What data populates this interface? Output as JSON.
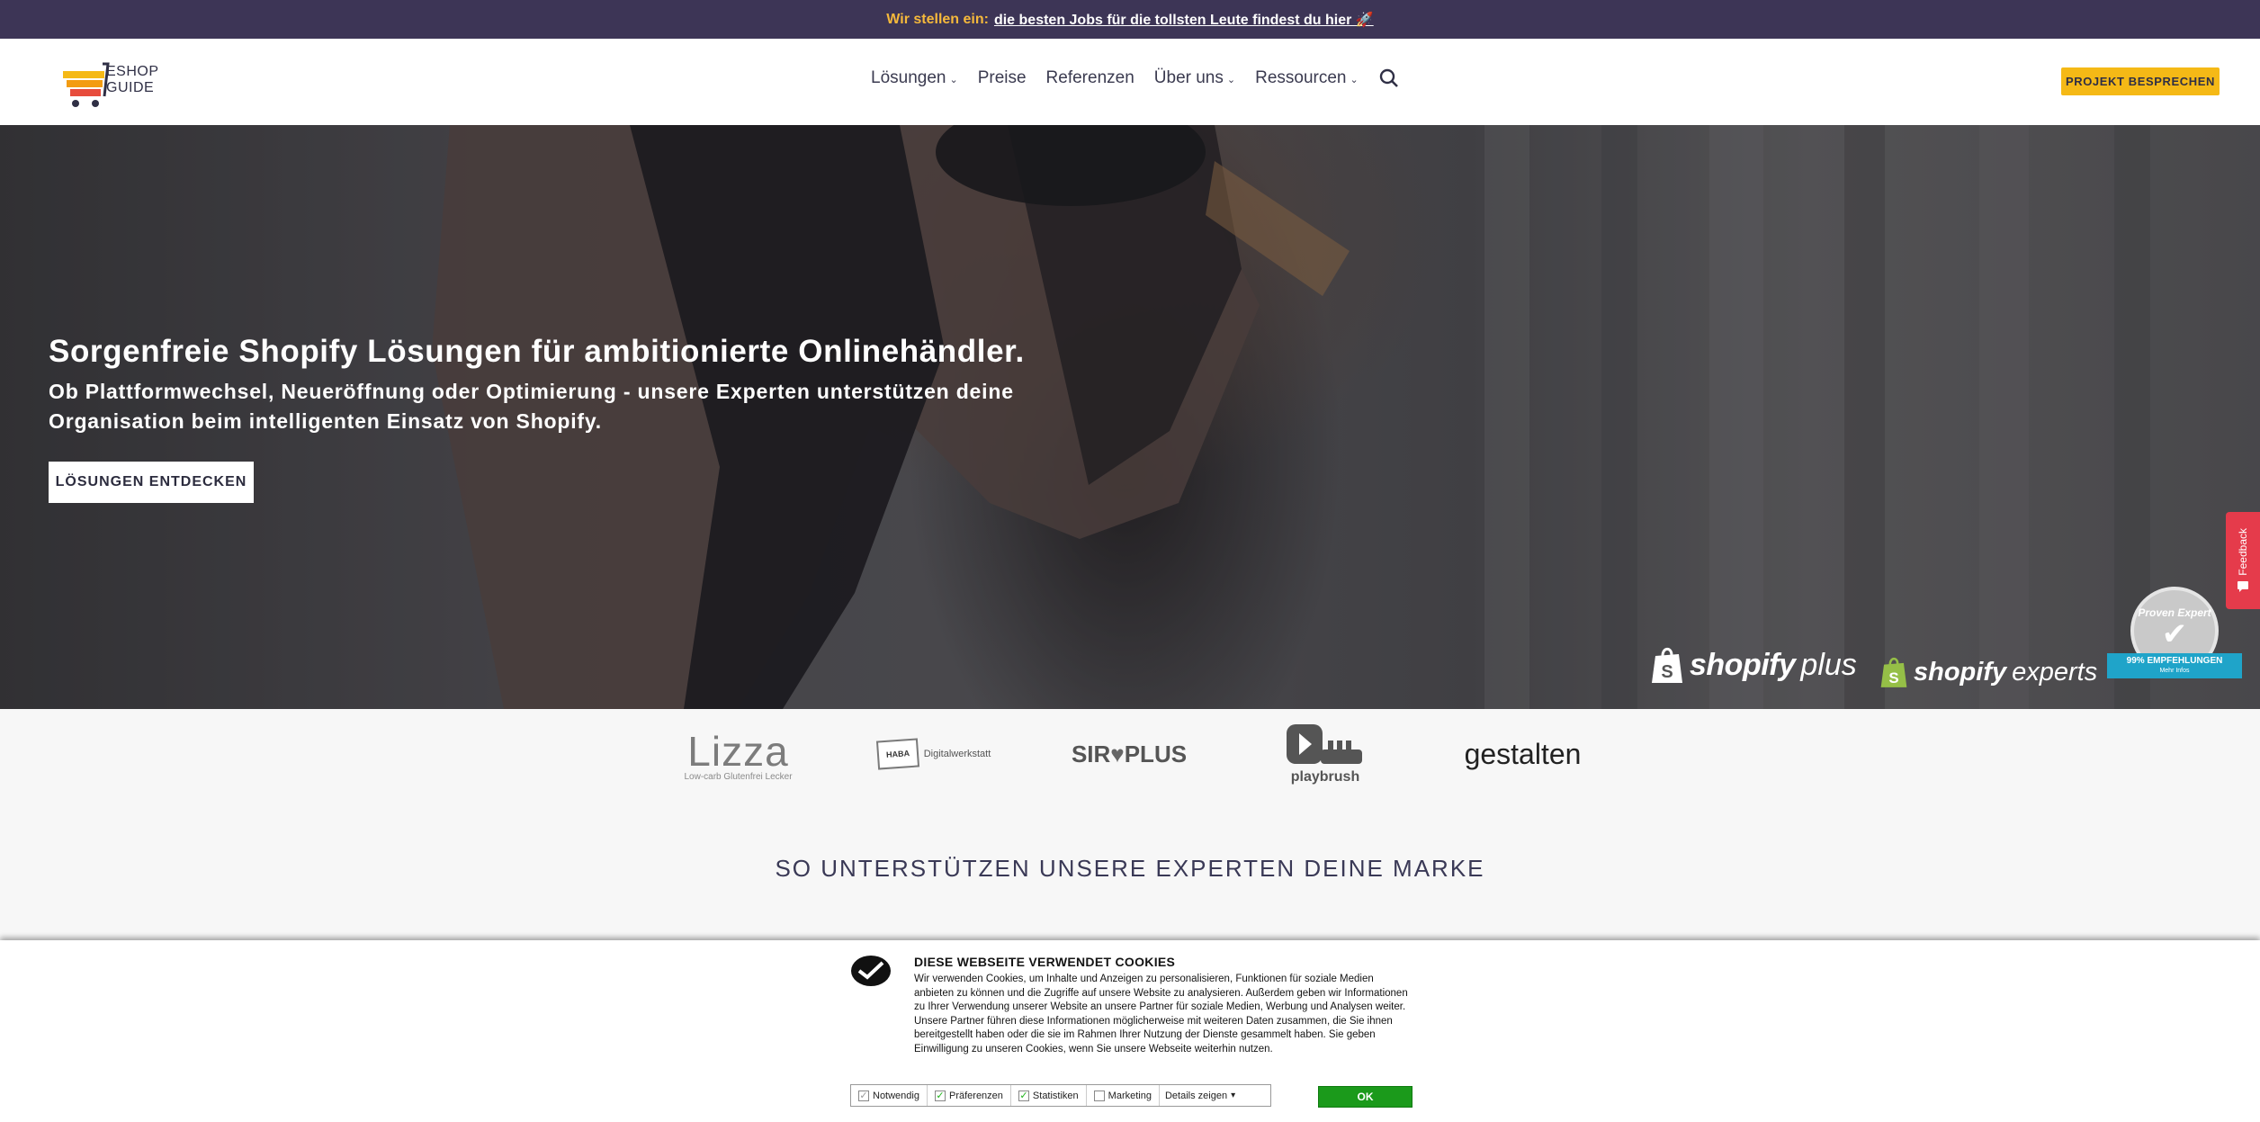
{
  "announcement": {
    "lead": "Wir stellen ein:",
    "link": "die besten Jobs für die tollsten Leute findest du hier 🚀"
  },
  "header": {
    "logo_line1": "ESHOP",
    "logo_line2": "GUIDE",
    "nav": [
      {
        "label": "Lösungen",
        "has_dropdown": true
      },
      {
        "label": "Preise",
        "has_dropdown": false
      },
      {
        "label": "Referenzen",
        "has_dropdown": false
      },
      {
        "label": "Über uns",
        "has_dropdown": true
      },
      {
        "label": "Ressourcen",
        "has_dropdown": true
      }
    ],
    "search_icon": "search-icon",
    "cta": "PROJEKT BESPRECHEN"
  },
  "hero": {
    "title": "Sorgenfreie Shopify Lösungen für ambitionierte Onlinehändler.",
    "subtitle": "Ob Plattformwechsel, Neueröffnung oder Optimierung - unsere Experten unterstützen deine Organisation beim intelligenten Einsatz von Shopify.",
    "button": "LÖSUNGEN ENTDECKEN",
    "badges": {
      "shopify_plus_word": "shopify",
      "shopify_plus_suffix": "plus",
      "shopify_experts_word": "shopify",
      "shopify_experts_suffix": "experts"
    },
    "seal": {
      "name": "Proven Expert",
      "ribbon": "99% EMPFEHLUNGEN",
      "more": "Mehr Infos"
    }
  },
  "feedback": {
    "label": "Feedback"
  },
  "client_logos": {
    "lizza_name": "Lizza",
    "lizza_tag": "Low-carb Glutenfrei Lecker",
    "haba_box": "HABA",
    "haba_text": "Digitalwerkstatt",
    "sirplus_left": "SIR",
    "sirplus_right": "PLUS",
    "playbrush": "playbrush",
    "gestalten": "gestalten"
  },
  "section": {
    "title": "SO UNTERSTÜTZEN UNSERE EXPERTEN DEINE MARKE"
  },
  "cookie": {
    "title": "DIESE WEBSEITE VERWENDET COOKIES",
    "text": "Wir verwenden Cookies, um Inhalte und Anzeigen zu personalisieren, Funktionen für soziale Medien anbieten zu können und die Zugriffe auf unsere Website zu analysieren. Außerdem geben wir Informationen zu Ihrer Verwendung unserer Website an unsere Partner für soziale Medien, Werbung und Analysen weiter. Unsere Partner führen diese Informationen möglicherweise mit weiteren Daten zusammen, die Sie ihnen bereitgestellt haben oder die sie im Rahmen Ihrer Nutzung der Dienste gesammelt haben. Sie geben Einwilligung zu unseren Cookies, wenn Sie unsere Webseite weiterhin nutzen.",
    "options": [
      {
        "label": "Notwendig",
        "checked": true
      },
      {
        "label": "Präferenzen",
        "checked": true
      },
      {
        "label": "Statistiken",
        "checked": true
      },
      {
        "label": "Marketing",
        "checked": false
      }
    ],
    "details": "Details zeigen",
    "ok": "OK"
  },
  "colors": {
    "announce_bg": "#3d3556",
    "accent_yellow": "#f5b916",
    "cookie_ok": "#1b9a1b",
    "feedback": "#e53b4b",
    "seal_ribbon": "#1fa4c9"
  }
}
